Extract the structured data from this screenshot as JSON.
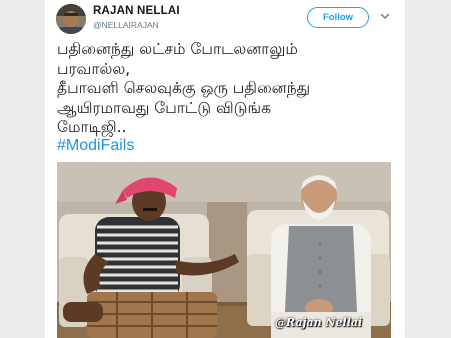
{
  "tweet": {
    "author_name": "RAJAN NELLAI",
    "author_handle": "@NELLAIRAJAN",
    "follow_label": "Follow",
    "text": "பதினைந்து லட்சம் போடலனாலும்\nபரவால்ல,\nதீபாவளி செலவுக்கு ஒரு பதினைந்து\nஆயிரமாவது  போட்டு விடுங்க\nமோடிஜி..",
    "hashtag": "#ModiFails",
    "image_watermark": "@Rajan Nellai"
  },
  "colors": {
    "accent": "#1da1f2",
    "hashtag": "#1b95e0",
    "text": "#14171a",
    "secondary": "#657786"
  },
  "icons": {
    "menu": "chevron-down-icon"
  }
}
